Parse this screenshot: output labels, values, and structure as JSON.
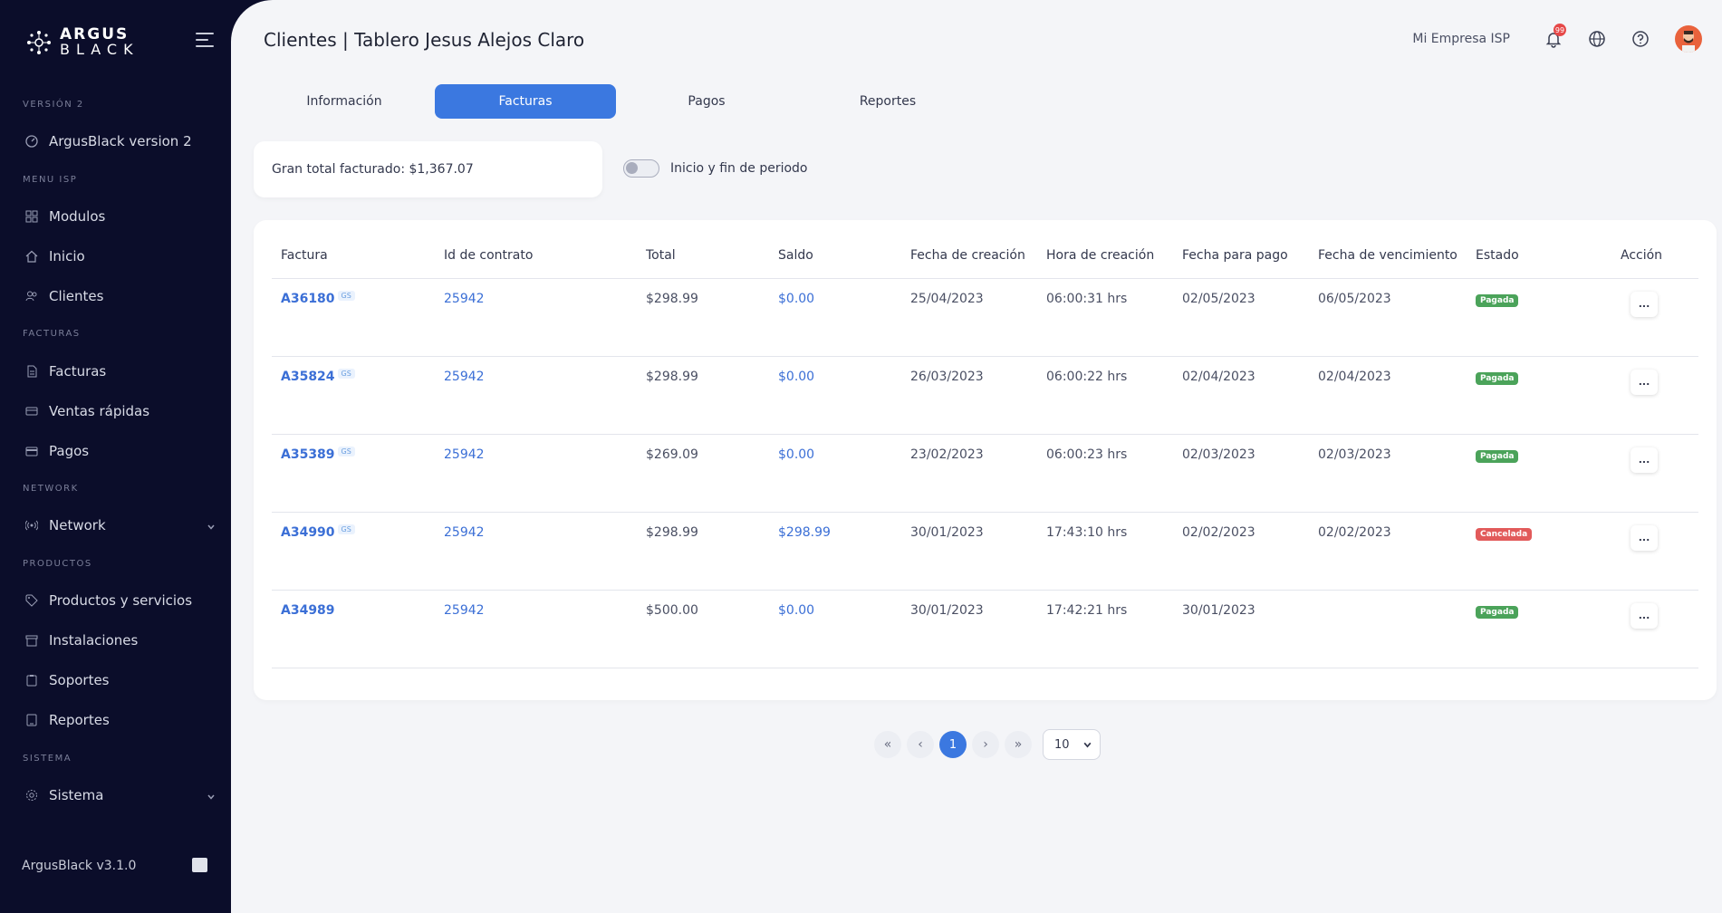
{
  "sidebar": {
    "logo_line1": "ARGUS",
    "logo_line2": "BLACK",
    "sections": {
      "version": "VERSIÓN 2",
      "menu_isp": "MENU ISP",
      "facturas": "FACTURAS",
      "network": "NETWORK",
      "productos": "PRODUCTOS",
      "sistema": "SISTEMA"
    },
    "items": {
      "argus_v2": "ArgusBlack version 2",
      "modulos": "Modulos",
      "inicio": "Inicio",
      "clientes": "Clientes",
      "facturas": "Facturas",
      "ventas": "Ventas rápidas",
      "pagos": "Pagos",
      "network": "Network",
      "productos": "Productos y servicios",
      "instalaciones": "Instalaciones",
      "soportes": "Soportes",
      "reportes": "Reportes",
      "sistema": "Sistema"
    },
    "version_footer": "ArgusBlack v3.1.0"
  },
  "header": {
    "title": "Clientes | Tablero Jesus Alejos Claro",
    "company": "Mi Empresa ISP",
    "notification_count": "99"
  },
  "tabs": [
    "Información",
    "Facturas",
    "Pagos",
    "Reportes"
  ],
  "active_tab": "Facturas",
  "summary": {
    "grand_total": "Gran total facturado: $1,367.07",
    "toggle_label": "Inicio y fin de periodo",
    "toggle_on": false
  },
  "table": {
    "headers": [
      "Factura",
      "Id de contrato",
      "Total",
      "Saldo",
      "Fecha de creación",
      "Hora de creación",
      "Fecha para pago",
      "Fecha de vencimiento",
      "Estado",
      "Acción"
    ],
    "rows": [
      {
        "factura": "A36180",
        "tag": "GS",
        "contrato": "25942",
        "total": "$298.99",
        "saldo": "$0.00",
        "fecha_creacion": "25/04/2023",
        "hora": "06:00:31 hrs",
        "fecha_pago": "02/05/2023",
        "vencimiento": "06/05/2023",
        "estado": "Pagada",
        "accion": "..."
      },
      {
        "factura": "A35824",
        "tag": "GS",
        "contrato": "25942",
        "total": "$298.99",
        "saldo": "$0.00",
        "fecha_creacion": "26/03/2023",
        "hora": "06:00:22 hrs",
        "fecha_pago": "02/04/2023",
        "vencimiento": "02/04/2023",
        "estado": "Pagada",
        "accion": "..."
      },
      {
        "factura": "A35389",
        "tag": "GS",
        "contrato": "25942",
        "total": "$269.09",
        "saldo": "$0.00",
        "fecha_creacion": "23/02/2023",
        "hora": "06:00:23 hrs",
        "fecha_pago": "02/03/2023",
        "vencimiento": "02/03/2023",
        "estado": "Pagada",
        "accion": "..."
      },
      {
        "factura": "A34990",
        "tag": "GS",
        "contrato": "25942",
        "total": "$298.99",
        "saldo": "$298.99",
        "fecha_creacion": "30/01/2023",
        "hora": "17:43:10 hrs",
        "fecha_pago": "02/02/2023",
        "vencimiento": "02/02/2023",
        "estado": "Cancelada",
        "accion": "..."
      },
      {
        "factura": "A34989",
        "tag": "",
        "contrato": "25942",
        "total": "$500.00",
        "saldo": "$0.00",
        "fecha_creacion": "30/01/2023",
        "hora": "17:42:21 hrs",
        "fecha_pago": "30/01/2023",
        "vencimiento": "",
        "estado": "Pagada",
        "accion": "..."
      }
    ]
  },
  "pagination": {
    "first": "«",
    "prev": "‹",
    "current": "1",
    "next": "›",
    "last": "»",
    "page_size": "10"
  },
  "colors": {
    "accent": "#3b78e0",
    "sidebar_bg": "#0b0d2a",
    "paid": "#4ba35a",
    "cancelled": "#e25a5a"
  }
}
